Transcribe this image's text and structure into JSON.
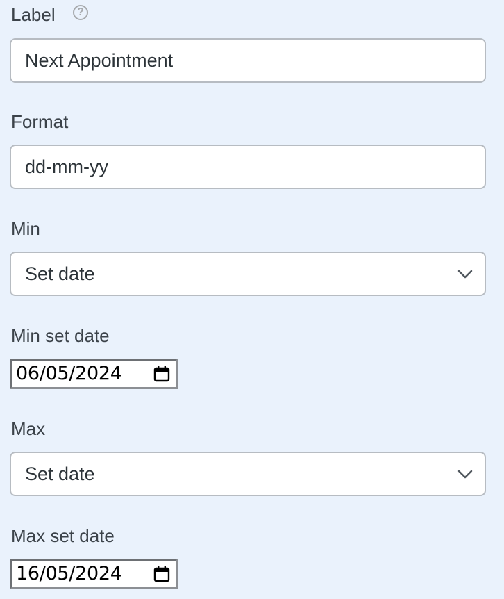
{
  "fields": {
    "label": {
      "label": "Label",
      "value": "Next Appointment",
      "help_icon": "question-mark-circle"
    },
    "format": {
      "label": "Format",
      "value": "dd-mm-yy"
    },
    "min": {
      "label": "Min",
      "selected": "Set date"
    },
    "min_set_date": {
      "label": "Min set date",
      "value": "06/05/2024"
    },
    "max": {
      "label": "Max",
      "selected": "Set date"
    },
    "max_set_date": {
      "label": "Max set date",
      "value": "16/05/2024"
    }
  },
  "icons": {
    "help": "question-circle-icon",
    "dropdown": "chevron-down-icon",
    "calendar": "calendar-icon"
  },
  "colors": {
    "background": "#eaf2fc",
    "input_border": "#b7bcc2",
    "label_text": "#3c434a"
  }
}
